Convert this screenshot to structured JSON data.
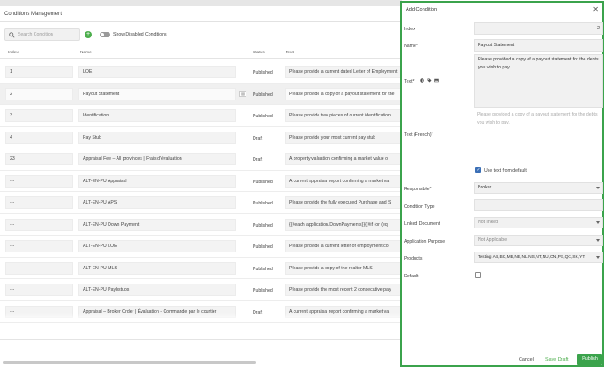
{
  "page": {
    "title": "Conditions Management"
  },
  "search": {
    "placeholder": "Search Condition"
  },
  "toolbar": {
    "add_label": "+",
    "toggle_label": "Show Disabled Conditions"
  },
  "table": {
    "columns": [
      "Index",
      "Name",
      "Status",
      "Text"
    ],
    "rows": [
      {
        "index": "1",
        "name": "LOE",
        "status": "Published",
        "text": "Please provide a current dated Letter of Employment"
      },
      {
        "index": "2",
        "name": "Payout Statement",
        "status": "Published",
        "text": "Please provide a copy of a payout statement for the"
      },
      {
        "index": "3",
        "name": "Identification",
        "status": "Published",
        "text": "Please provide two pieces of current identification"
      },
      {
        "index": "4",
        "name": "Pay Stub",
        "status": "Draft",
        "text": "Please provide your most current pay stub"
      },
      {
        "index": "23",
        "name": "Appraisal Fee – All provinces | Frais d'évaluation",
        "status": "Draft",
        "text": "A property valuation confirming a market value o"
      },
      {
        "index": "---",
        "name": "ALT-EN-PU Appraisal",
        "status": "Published",
        "text": "A current appraisal report confirming a market va"
      },
      {
        "index": "---",
        "name": "ALT-EN-PU APS",
        "status": "Published",
        "text": "Please provide the fully executed Purchase and S"
      },
      {
        "index": "---",
        "name": "ALT-EN-PU Down Payment",
        "status": "Published",
        "text": "{{#each application.DownPayments}}{{#if (or (eq"
      },
      {
        "index": "---",
        "name": "ALT-EN-PU LOE",
        "status": "Published",
        "text": "Please provide a current letter of employment co"
      },
      {
        "index": "---",
        "name": "ALT-EN-PU MLS",
        "status": "Published",
        "text": "Please provide a copy of the realtor MLS"
      },
      {
        "index": "---",
        "name": "ALT-EN-PU Paybstubs",
        "status": "Published",
        "text": "Please provide the most recent 2 consecutive pay"
      },
      {
        "index": "---",
        "name": "Appraisal – Broker Order | Évaluation - Commande par le courtier",
        "status": "Draft",
        "text": "A current appraisal report confirming a market va"
      }
    ]
  },
  "panel": {
    "title": "Add Condition",
    "close_label": "✕",
    "index_label": "Index",
    "index_value": "2",
    "name_label": "Name*",
    "name_value": "Payout Statement",
    "text_label": "Text*",
    "text_value": "Please provided a copy of a payout statement for the debts you wish to pay.",
    "text_french_label": "Text (French)*",
    "text_french_hint": "Please provided a copy of a payout statement for the debts you wish to pay.",
    "use_text_label": "Use text from default",
    "use_text_checked": true,
    "responsible_label": "Responsible*",
    "responsible_value": "Broker",
    "condition_type_label": "Condition Type",
    "condition_type_value": "",
    "linked_document_label": "Linked Document",
    "linked_document_value": "Not linked",
    "application_purpose_label": "Application Purpose",
    "application_purpose_value": "Not Applicable",
    "products_label": "Products",
    "products_value": "Testing AB,BC,MB,NB,NL,NS,NT,NU,ON,PE,QC,SK,YT,",
    "default_label": "Default",
    "default_checked": false,
    "cancel_label": "Cancel",
    "save_draft_label": "Save Draft",
    "publish_label": "Publish"
  },
  "colors": {
    "accent": "#3ba34c",
    "checkbox": "#3b6fb6",
    "add_button": "#4cae4c"
  },
  "icons": [
    "search-icon",
    "add-icon",
    "toggle-icon",
    "info-icon",
    "tag-icon",
    "image-icon",
    "close-icon",
    "chevron-down-icon"
  ]
}
